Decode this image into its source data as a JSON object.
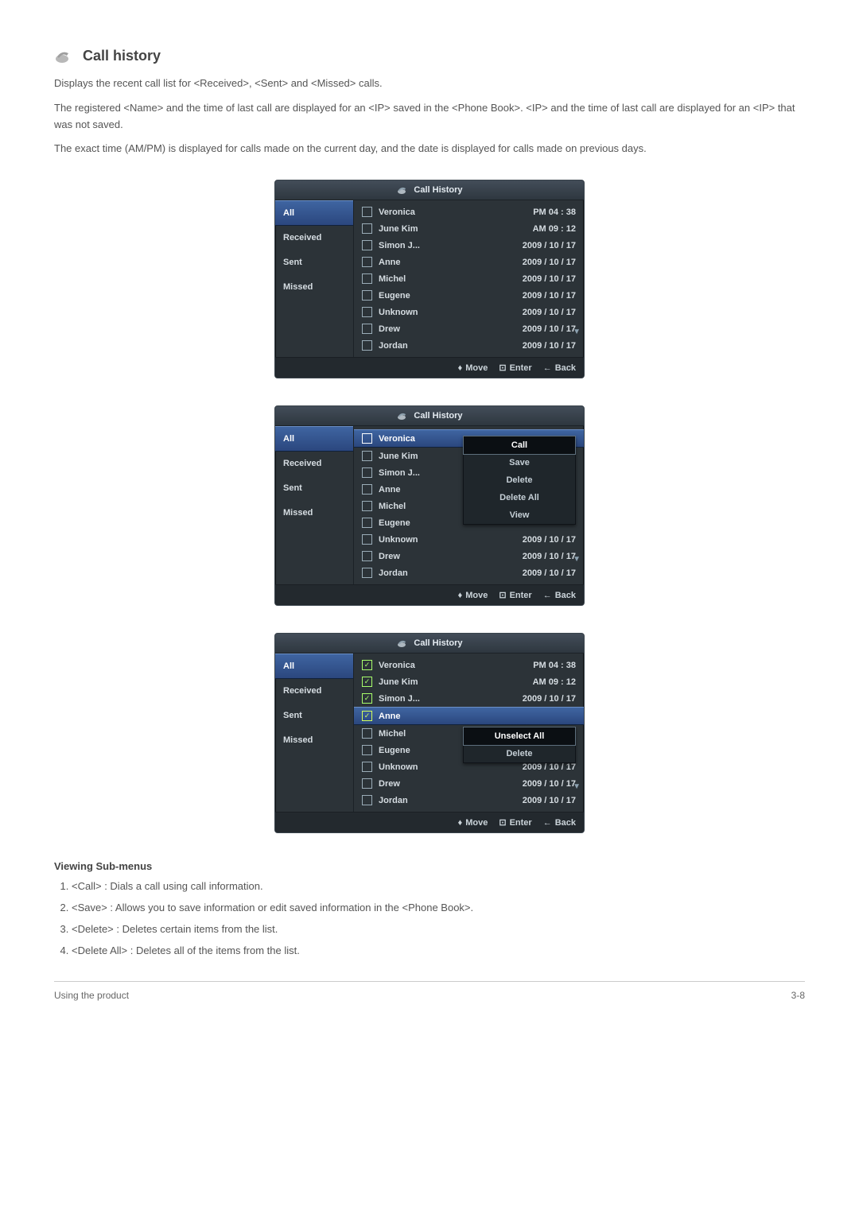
{
  "section": {
    "title": "Call history",
    "p1": "Displays the recent call list for <Received>, <Sent> and <Missed> calls.",
    "p2": "The registered <Name> and the time of last call are displayed for an <IP> saved in the <Phone Book>. <IP> and the time of last call are displayed for an <IP> that was not saved.",
    "p3": "The exact time (AM/PM) is displayed for calls made on the current day, and the date is displayed for calls made on previous days."
  },
  "panel": {
    "title": "Call History",
    "tabs": {
      "all": "All",
      "received": "Received",
      "sent": "Sent",
      "missed": "Missed"
    },
    "rows": [
      {
        "name": "Veronica",
        "time": "PM    04 : 38"
      },
      {
        "name": "June Kim",
        "time": "AM    09 : 12"
      },
      {
        "name": "Simon J...",
        "time": "2009 / 10 / 17"
      },
      {
        "name": "Anne",
        "time": "2009 / 10 / 17"
      },
      {
        "name": "Michel",
        "time": "2009 / 10 / 17"
      },
      {
        "name": "Eugene",
        "time": "2009 / 10 / 17"
      },
      {
        "name": "Unknown",
        "time": "2009 / 10 / 17"
      },
      {
        "name": "Drew",
        "time": "2009 / 10 / 17"
      },
      {
        "name": "Jordan",
        "time": "2009 / 10 / 17"
      }
    ],
    "popup1": {
      "call": "Call",
      "save": "Save",
      "delete": "Delete",
      "delete_all": "Delete All",
      "view": "View"
    },
    "popup2": {
      "unselect_all": "Unselect All",
      "delete": "Delete"
    },
    "hints": {
      "move": "Move",
      "enter": "Enter",
      "back": "Back"
    }
  },
  "subsection": {
    "title": "Viewing Sub-menus",
    "i1": "<Call> : Dials a call using call information.",
    "i2": "<Save> : Allows you to save information or edit saved information in the <Phone Book>.",
    "i3": "<Delete> : Deletes certain items from the list.",
    "i4": "<Delete All> : Deletes all of the items from the list."
  },
  "footer": {
    "left": "Using the product",
    "right": "3-8"
  }
}
